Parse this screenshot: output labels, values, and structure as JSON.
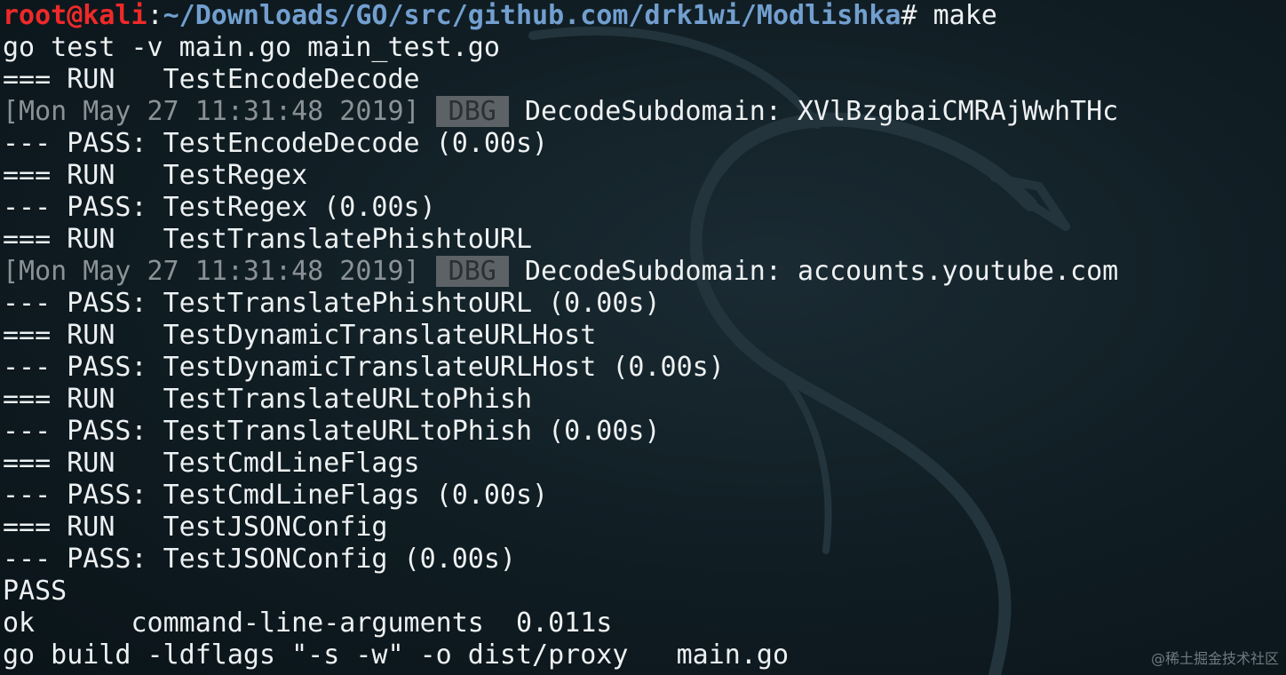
{
  "terminal": {
    "prompt": {
      "user_host": "root@kali",
      "sep": ":",
      "path": "~/Downloads/GO/src/github.com/drk1wi/Modlishka",
      "hash": "# ",
      "command": "make"
    },
    "lines": [
      "go test -v main.go main_test.go",
      "=== RUN   TestEncodeDecode",
      null,
      "--- PASS: TestEncodeDecode (0.00s)",
      "=== RUN   TestRegex",
      "--- PASS: TestRegex (0.00s)",
      "=== RUN   TestTranslatePhishtoURL",
      null,
      "--- PASS: TestTranslatePhishtoURL (0.00s)",
      "=== RUN   TestDynamicTranslateURLHost",
      "--- PASS: TestDynamicTranslateURLHost (0.00s)",
      "=== RUN   TestTranslateURLtoPhish",
      "--- PASS: TestTranslateURLtoPhish (0.00s)",
      "=== RUN   TestCmdLineFlags",
      "--- PASS: TestCmdLineFlags (0.00s)",
      "=== RUN   TestJSONConfig",
      "--- PASS: TestJSONConfig (0.00s)",
      "PASS",
      "ok      command-line-arguments  0.011s",
      "go build -ldflags \"-s -w\" -o dist/proxy   main.go"
    ],
    "debug_1": {
      "timestamp": "[Mon May 27 11:31:48 2019]",
      "level": "DBG",
      "message": "DecodeSubdomain: XVlBzgbaiCMRAjWwhTHc"
    },
    "debug_2": {
      "timestamp": "[Mon May 27 11:31:48 2019]",
      "level": "DBG",
      "message": "DecodeSubdomain: accounts.youtube.com"
    }
  },
  "watermark": "@稀土掘金技术社区",
  "colors": {
    "background": "#0d1a20",
    "text": "#eef1f2",
    "prompt_user": "#ef2929",
    "prompt_path": "#729fcf",
    "dim": "#8a9297",
    "badge_bg": "#5c6266"
  },
  "icons": {
    "background_art": "kali-dragon-icon"
  }
}
